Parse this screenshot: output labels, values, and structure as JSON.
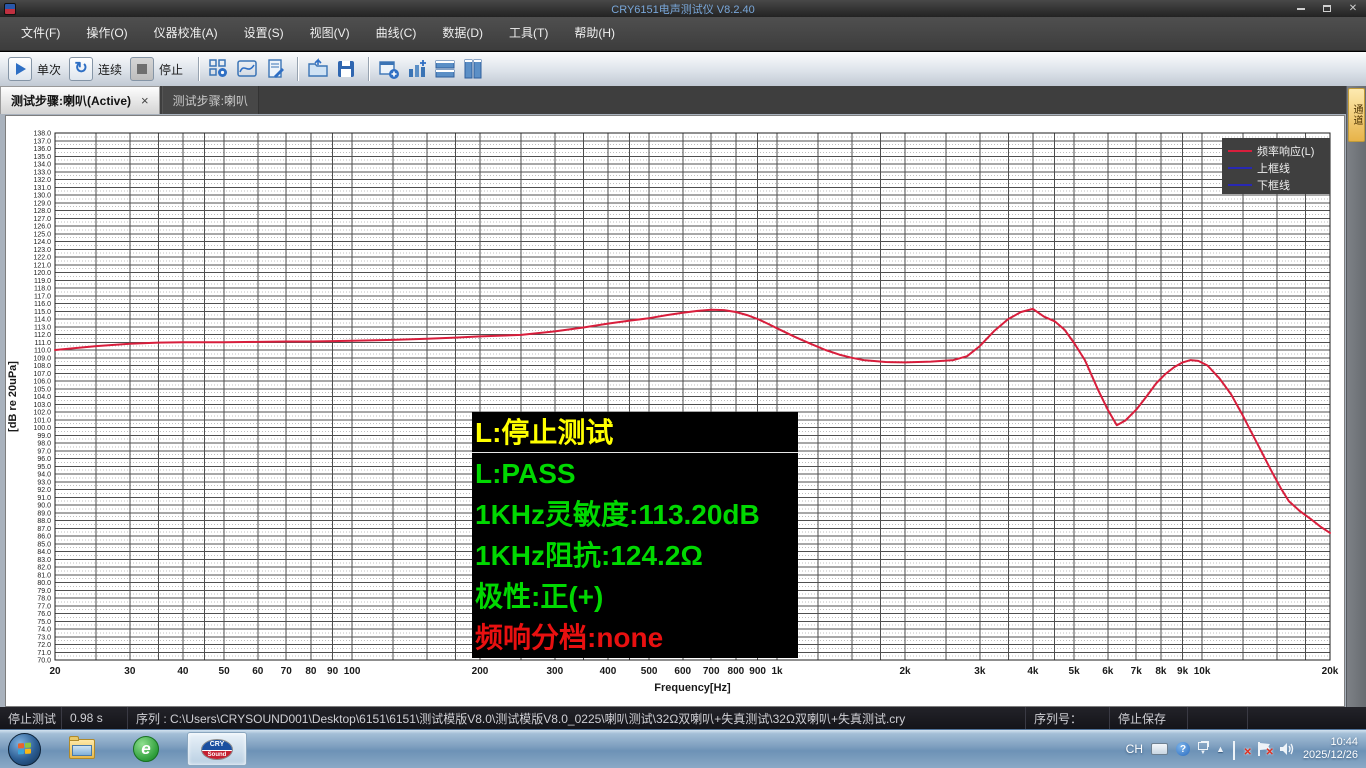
{
  "window": {
    "title": "CRY6151电声测试仪 V8.2.40",
    "close_glyph": "✕"
  },
  "menu": {
    "items": [
      {
        "label": "文件(F)"
      },
      {
        "label": "操作(O)"
      },
      {
        "label": "仪器校准(A)"
      },
      {
        "label": "设置(S)"
      },
      {
        "label": "视图(V)"
      },
      {
        "label": "曲线(C)"
      },
      {
        "label": "数据(D)"
      },
      {
        "label": "工具(T)"
      },
      {
        "label": "帮助(H)"
      }
    ]
  },
  "toolbar": {
    "single_label": "单次",
    "continuous_label": "连续",
    "stop_label": "停止",
    "loop_glyph": "↻"
  },
  "tabs": [
    {
      "label": "测试步骤:喇叭(Active)",
      "close_glyph": "×",
      "active": true
    },
    {
      "label": "测试步骤:喇叭",
      "active": false
    }
  ],
  "side_tab": {
    "label": "通道"
  },
  "chart_data": {
    "type": "line",
    "title": "",
    "xlabel": "Frequency[Hz]",
    "ylabel": "[dB re 20uPa]",
    "x_scale": "log",
    "xlim": [
      20,
      20000
    ],
    "ylim": [
      70,
      138
    ],
    "y_tick_step": 1,
    "grid": true,
    "legend_position": "top-right",
    "x_ticks": [
      20,
      30,
      40,
      50,
      60,
      70,
      80,
      90,
      100,
      200,
      300,
      400,
      500,
      600,
      700,
      800,
      900,
      1000,
      2000,
      3000,
      4000,
      5000,
      6000,
      7000,
      8000,
      9000,
      10000,
      20000
    ],
    "x_tick_labels": [
      "20",
      "30",
      "40",
      "50",
      "60",
      "70",
      "80",
      "90",
      "100",
      "200",
      "300",
      "400",
      "500",
      "600",
      "700",
      "800",
      "900",
      "1k",
      "2k",
      "3k",
      "4k",
      "5k",
      "6k",
      "7k",
      "8k",
      "9k",
      "10k",
      "20k"
    ],
    "x_gridlines": [
      20,
      25,
      30,
      35,
      40,
      45,
      50,
      60,
      70,
      80,
      90,
      100,
      125,
      150,
      175,
      200,
      250,
      300,
      350,
      400,
      450,
      500,
      600,
      700,
      800,
      900,
      1000,
      1250,
      1500,
      1750,
      2000,
      2500,
      3000,
      3500,
      4000,
      4500,
      5000,
      6000,
      7000,
      8000,
      9000,
      10000,
      12500,
      15000,
      17500,
      20000
    ],
    "legend": [
      {
        "label": "频率响应(L)",
        "color": "#d81e3c"
      },
      {
        "label": "上框线",
        "color": "#2828b4"
      },
      {
        "label": "下框线",
        "color": "#2828b4"
      }
    ],
    "series": [
      {
        "name": "频率响应(L)",
        "color": "#d81e3c",
        "points": [
          [
            20,
            110.0
          ],
          [
            25,
            110.5
          ],
          [
            30,
            110.8
          ],
          [
            35,
            110.95
          ],
          [
            40,
            111.0
          ],
          [
            50,
            111.0
          ],
          [
            60,
            111.05
          ],
          [
            70,
            111.1
          ],
          [
            80,
            111.1
          ],
          [
            90,
            111.15
          ],
          [
            100,
            111.2
          ],
          [
            125,
            111.3
          ],
          [
            150,
            111.45
          ],
          [
            175,
            111.6
          ],
          [
            200,
            111.75
          ],
          [
            250,
            111.95
          ],
          [
            300,
            112.4
          ],
          [
            350,
            112.9
          ],
          [
            400,
            113.4
          ],
          [
            450,
            113.8
          ],
          [
            500,
            114.1
          ],
          [
            550,
            114.5
          ],
          [
            600,
            114.8
          ],
          [
            650,
            115.05
          ],
          [
            700,
            115.2
          ],
          [
            750,
            115.15
          ],
          [
            800,
            114.9
          ],
          [
            850,
            114.5
          ],
          [
            900,
            114.0
          ],
          [
            950,
            113.4
          ],
          [
            1000,
            112.8
          ],
          [
            1100,
            111.7
          ],
          [
            1200,
            110.8
          ],
          [
            1300,
            110.0
          ],
          [
            1400,
            109.4
          ],
          [
            1500,
            109.0
          ],
          [
            1600,
            108.7
          ],
          [
            1800,
            108.45
          ],
          [
            2000,
            108.4
          ],
          [
            2300,
            108.5
          ],
          [
            2600,
            108.7
          ],
          [
            2800,
            109.2
          ],
          [
            3000,
            110.5
          ],
          [
            3250,
            112.5
          ],
          [
            3500,
            114.0
          ],
          [
            3750,
            114.9
          ],
          [
            4000,
            115.3
          ],
          [
            4250,
            114.3
          ],
          [
            4500,
            113.7
          ],
          [
            4750,
            112.6
          ],
          [
            5000,
            110.9
          ],
          [
            5300,
            108.7
          ],
          [
            5700,
            104.8
          ],
          [
            6000,
            102.3
          ],
          [
            6300,
            100.3
          ],
          [
            6600,
            100.9
          ],
          [
            7000,
            102.3
          ],
          [
            7400,
            104.0
          ],
          [
            7800,
            105.7
          ],
          [
            8200,
            106.9
          ],
          [
            8600,
            107.8
          ],
          [
            9000,
            108.4
          ],
          [
            9400,
            108.7
          ],
          [
            9800,
            108.6
          ],
          [
            10300,
            108.0
          ],
          [
            11000,
            106.3
          ],
          [
            11700,
            104.3
          ],
          [
            12400,
            101.8
          ],
          [
            13000,
            99.6
          ],
          [
            13700,
            97.2
          ],
          [
            14500,
            94.6
          ],
          [
            15300,
            92.2
          ],
          [
            16000,
            90.5
          ],
          [
            17000,
            89.2
          ],
          [
            18000,
            88.2
          ],
          [
            19000,
            87.2
          ],
          [
            20000,
            86.4
          ]
        ]
      }
    ]
  },
  "result_panel": {
    "lines": [
      {
        "text": "L:停止测试",
        "color": "#ffff00"
      },
      {
        "text": "L:PASS",
        "color": "#00d800"
      },
      {
        "text": "1KHz灵敏度:113.20dB",
        "color": "#00d800"
      },
      {
        "text": "1KHz阻抗:124.2Ω",
        "color": "#00d800"
      },
      {
        "text": "极性:正(+)",
        "color": "#00d800"
      },
      {
        "text": "频响分档:none",
        "color": "#e81010"
      }
    ]
  },
  "status_bar": {
    "state": "停止测试",
    "elapsed": "0.98 s",
    "sequence": "序列 : C:\\Users\\CRYSOUND001\\Desktop\\6151\\6151\\测试模版V8.0\\测试模版V8.0_0225\\喇叭测试\\32Ω双喇叭+失真测试\\32Ω双喇叭+失真测试.cry",
    "serial_label": "序列号：",
    "save_state": "停止保存"
  },
  "taskbar": {
    "tray_lang": "CH",
    "browser_glyph": "e",
    "app_logo_top": "CRY",
    "app_logo_bottom": "Sound",
    "clock_time": "10:44",
    "clock_date": "2025/12/26"
  }
}
